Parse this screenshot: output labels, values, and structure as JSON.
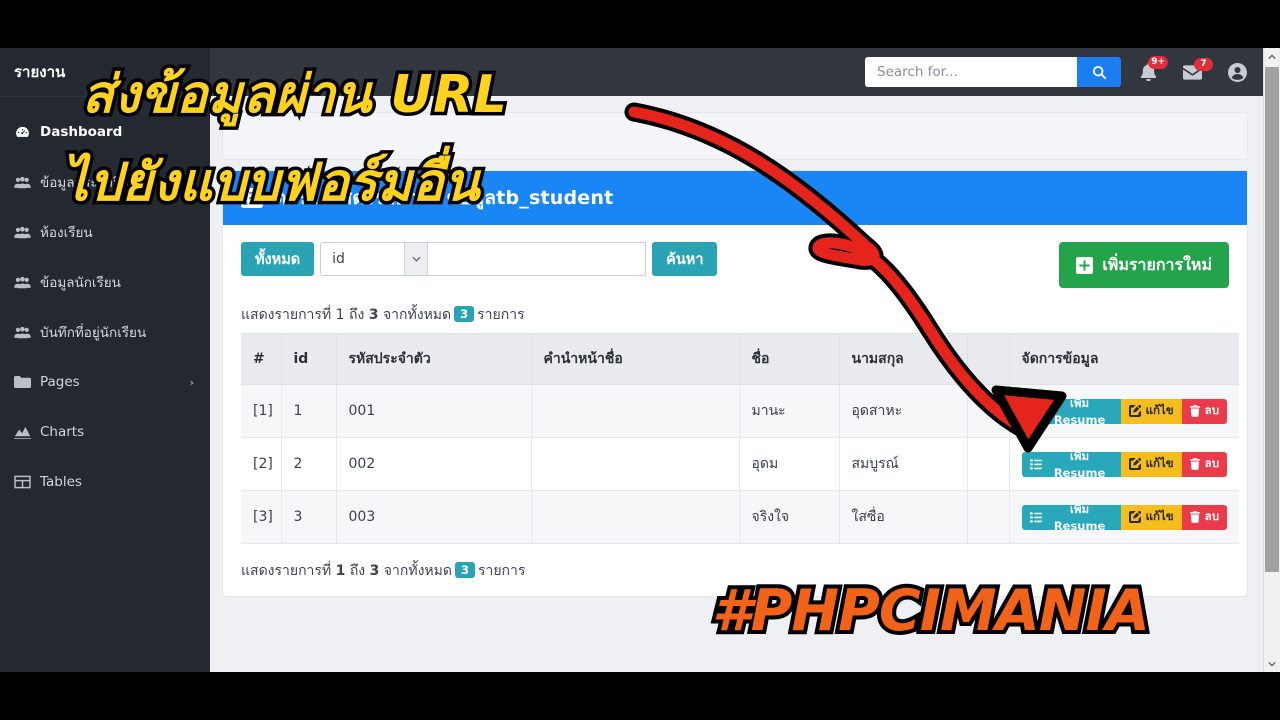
{
  "sidebar": {
    "brand": "รายงาน",
    "items": [
      {
        "label": "Dashboard",
        "icon": "dashboard-icon",
        "active": true
      },
      {
        "label": "ข้อมูลประจำปีการศึกษา",
        "icon": "users-icon",
        "active": false
      },
      {
        "label": "ห้องเรียน",
        "icon": "users-icon",
        "active": false
      },
      {
        "label": "ข้อมูลนักเรียน",
        "icon": "users-icon",
        "active": false
      },
      {
        "label": "บันทึกที่อยู่นักเรียน",
        "icon": "users-icon",
        "active": false
      },
      {
        "label": "Pages",
        "icon": "folder-icon",
        "active": false,
        "chevron": "›"
      },
      {
        "label": "Charts",
        "icon": "chart-area-icon",
        "active": false
      },
      {
        "label": "Tables",
        "icon": "table-icon",
        "active": false
      }
    ]
  },
  "topbar": {
    "search_placeholder": "Search for...",
    "search_value": "",
    "notifications_badge": "9+",
    "messages_badge": "7"
  },
  "card": {
    "title_prefix": "ตารางแสดงรายการ ข้อมูล",
    "title_strong": "tb_student",
    "icon": "list-alt-icon"
  },
  "toolbar": {
    "all_label": "ทั้งหมด",
    "field_selected": "id",
    "field_options": [
      "id"
    ],
    "keyword_value": "",
    "keyword_placeholder": "",
    "search_label": "ค้นหา",
    "add_label": "เพิ่มรายการใหม่"
  },
  "summary": {
    "prefix": "แสดงรายการที่",
    "from": "1",
    "middle": "ถึง",
    "to": "3",
    "of_text": "จากทั้งหมด",
    "total": "3",
    "suffix": "รายการ"
  },
  "table": {
    "columns": [
      "#",
      "id",
      "รหัสประจำตัว",
      "คำนำหน้าชื่อ",
      "ชื่อ",
      "นามสกุล",
      "",
      "จัดการข้อมูล"
    ],
    "rows": [
      {
        "no": "[1]",
        "id": "1",
        "code": "001",
        "prefix": "",
        "firstname": "มานะ",
        "lastname": "อุดสาหะ"
      },
      {
        "no": "[2]",
        "id": "2",
        "code": "002",
        "prefix": "",
        "firstname": "อุดม",
        "lastname": "สมบูรณ์"
      },
      {
        "no": "[3]",
        "id": "3",
        "code": "003",
        "prefix": "",
        "firstname": "จริงใจ",
        "lastname": "ใสซื่อ"
      }
    ],
    "actions": {
      "resume_label": "เพิ่ม Resume",
      "edit_label": "แก้ไข",
      "delete_label": "ลบ"
    }
  },
  "overlay": {
    "line1": "ส่งข้อมูลผ่าน URL",
    "line2": "ไปยังแบบฟอร์มอื่น",
    "watermark": "#PHPCIMANIA"
  },
  "colors": {
    "sidebar": "#242830",
    "topbar": "#32363e",
    "card_header": "#1a86f5",
    "teal": "#2aa3b5",
    "green": "#23a34a",
    "yellow": "#f5bd1e",
    "red": "#ea3b4a",
    "overlay_text": "#ffd21e",
    "watermark": "#f2631a"
  }
}
